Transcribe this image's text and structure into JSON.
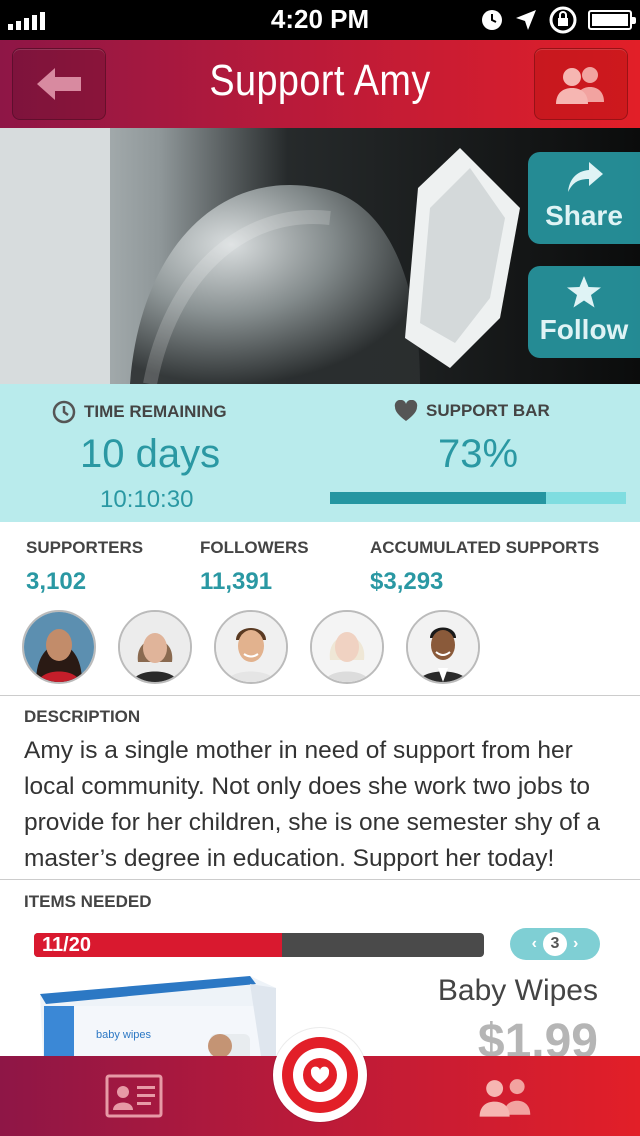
{
  "status_bar": {
    "time": "4:20 PM"
  },
  "nav": {
    "title": "Support Amy"
  },
  "hero": {
    "share_label": "Share",
    "follow_label": "Follow"
  },
  "stats": {
    "time_heading": "TIME REMAINING",
    "days": "10 days",
    "clock": "10:10:30",
    "bar_heading": "SUPPORT BAR",
    "percent_label": "73%",
    "percent_value": 0.73
  },
  "counts": {
    "supporters_label": "SUPPORTERS",
    "supporters_value": "3,102",
    "followers_label": "FOLLOWERS",
    "followers_value": "11,391",
    "accumulated_label": "ACCUMULATED SUPPORTS",
    "accumulated_value": "$3,293"
  },
  "description": {
    "heading": "DESCRIPTION",
    "text": "Amy is a single mother in need of support from her local community. Not only does she work two jobs to provide for her children, she is one semester shy of a master’s degree in education. Support her today!"
  },
  "items": {
    "heading": "ITEMS NEEDED",
    "progress_label": "11/20",
    "progress_value": 0.55,
    "page": "3",
    "item_name": "Baby Wipes",
    "item_price": "$1.99",
    "product_text": "baby wipes"
  },
  "colors": {
    "accent": "#2a98a3",
    "brand_red": "#e21f28",
    "brand_dark": "#8e1646",
    "stats_bg": "#b9ebec"
  }
}
